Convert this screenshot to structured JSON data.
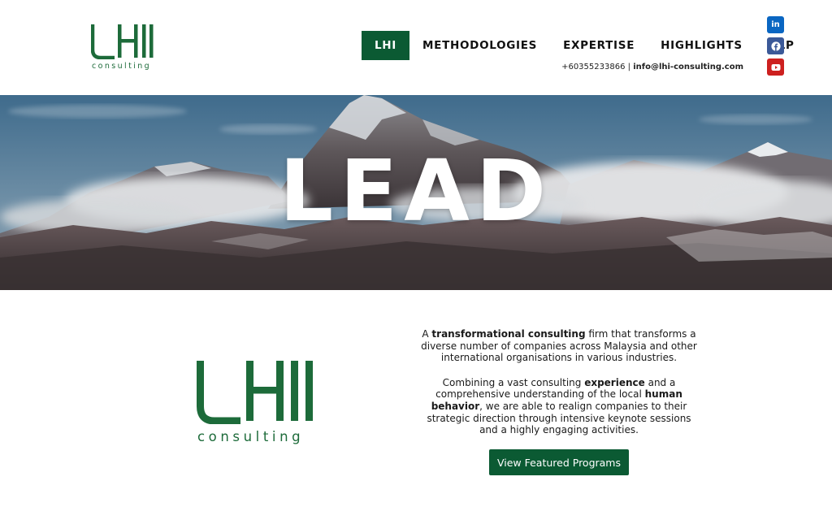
{
  "brand": {
    "logo_text": "consulting",
    "accent_color": "#0b5a33"
  },
  "nav": {
    "items": [
      {
        "label": "LHI",
        "active": true
      },
      {
        "label": "METHODOLOGIES",
        "active": false
      },
      {
        "label": "EXPERTISE",
        "active": false
      },
      {
        "label": "HIGHLIGHTS",
        "active": false
      },
      {
        "label": "DLP",
        "active": false
      }
    ]
  },
  "contact": {
    "phone": "+60355233866",
    "separator": " | ",
    "email": "info@lhi-consulting.com"
  },
  "social": [
    {
      "icon": "linkedin-icon",
      "glyph": "in",
      "color": "#0a66c2"
    },
    {
      "icon": "facebook-icon",
      "glyph": "f",
      "color": "#3b5998"
    },
    {
      "icon": "youtube-icon",
      "glyph": "▶",
      "color": "#cd201f"
    }
  ],
  "hero": {
    "title": "LEAD"
  },
  "about": {
    "p1": {
      "pre": "A ",
      "bold1": "transformational consulting",
      "post": " firm that transforms a diverse number of companies across Malaysia and other international organisations in various industries."
    },
    "p2": {
      "pre": "Combining a vast consulting ",
      "bold1": "experience",
      "mid": " and a comprehensive understanding of the local ",
      "bold2": "human behavior",
      "post": ", we are able to realign companies to their strategic direction through intensive keynote sessions and  a highly engaging activities."
    }
  },
  "cta": {
    "label": "View Featured Programs"
  }
}
